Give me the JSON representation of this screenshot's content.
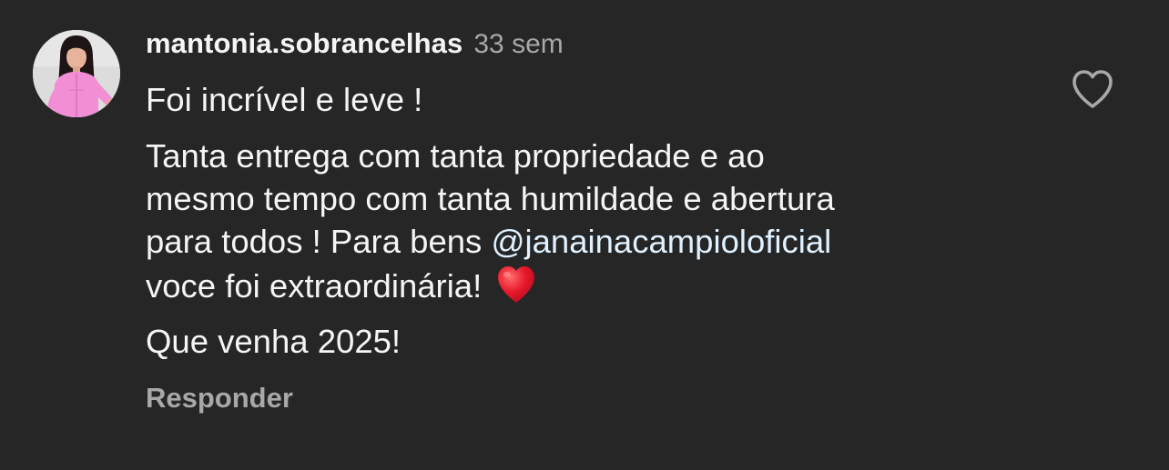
{
  "comment": {
    "username": "mantonia.sobrancelhas",
    "timestamp": "33 sem",
    "line1": "Foi incrível e leve !",
    "line2a": "Tanta entrega com tanta propriedade e ao",
    "line2b": "mesmo tempo com tanta humildade e abertura",
    "line2c": "para todos !  Para bens ",
    "mention": "@janainacampioloficial",
    "line2d": "voce foi extraordinária!",
    "emoji": "heart-emoji",
    "line3": "Que venha 2025!",
    "reply_label": "Responder",
    "like_icon": "heart-outline-icon",
    "mention_color": "#e0f1ff",
    "background_color": "#262626"
  }
}
